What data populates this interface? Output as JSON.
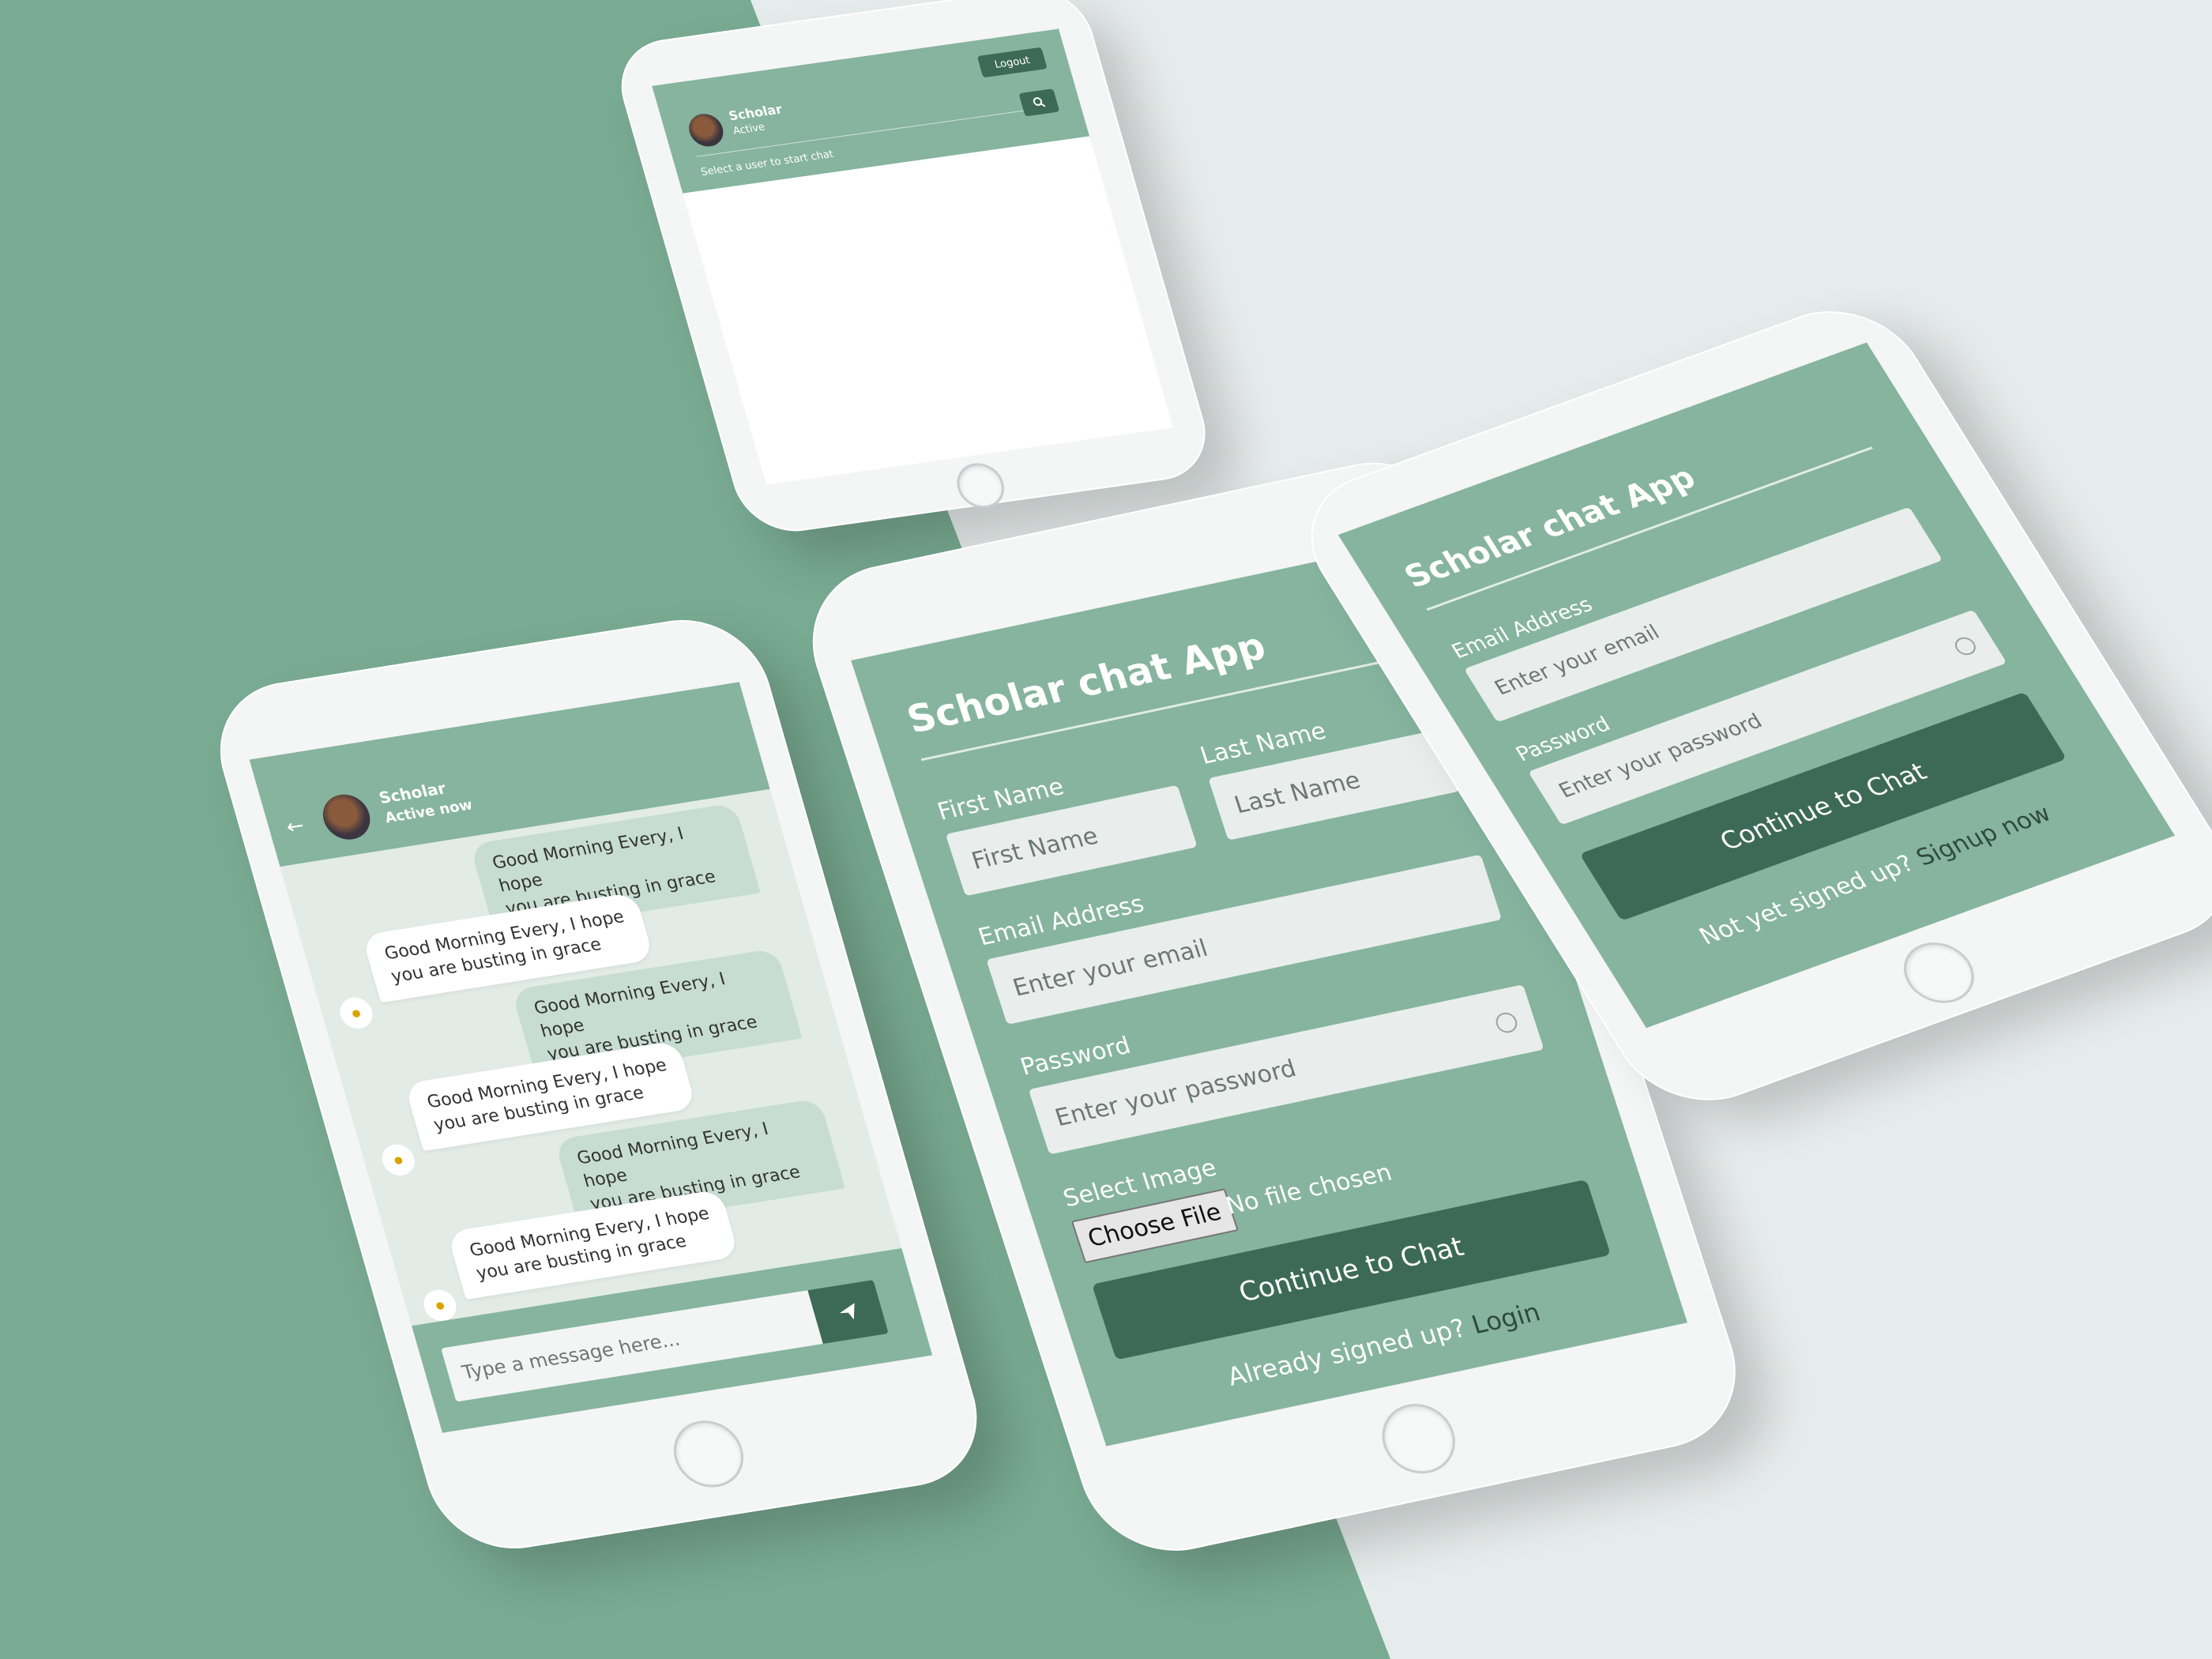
{
  "colors": {
    "brand_green": "#86b49f",
    "dark_green": "#3d6a57",
    "background_green": "#79aa92",
    "background_light": "#e6eceb",
    "field_bg": "#e9eeec"
  },
  "users_phone": {
    "user_name": "Scholar",
    "user_status": "Active",
    "logout_label": "Logout",
    "search_icon": "search-icon",
    "prompt": "Select a user to start chat"
  },
  "chat_phone": {
    "back_icon": "arrow-left-icon",
    "contact_name": "Scholar",
    "contact_status": "Active now",
    "messages": [
      {
        "dir": "out",
        "line1": "Good Morning Every, I hope",
        "line2": "you are busting in grace"
      },
      {
        "dir": "in",
        "line1": "Good Morning Every, I hope",
        "line2": "you are busting in grace"
      },
      {
        "dir": "out",
        "line1": "Good Morning Every, I hope",
        "line2": "you are busting in grace"
      },
      {
        "dir": "in",
        "line1": "Good Morning Every, I hope",
        "line2": "you are busting in grace"
      },
      {
        "dir": "out",
        "line1": "Good Morning Every, I hope",
        "line2": "you are busting in grace"
      },
      {
        "dir": "in",
        "line1": "Good Morning Every, I hope",
        "line2": "you are busting in grace"
      }
    ],
    "input_placeholder": "Type a message here...",
    "send_icon": "send-icon"
  },
  "signup_phone": {
    "title": "Scholar chat App",
    "first_name_label": "First Name",
    "first_name_placeholder": "First Name",
    "last_name_label": "Last Name",
    "last_name_placeholder": "Last Name",
    "email_label": "Email Address",
    "email_placeholder": "Enter your email",
    "password_label": "Password",
    "password_placeholder": "Enter your password",
    "eye_icon": "eye-icon",
    "image_label": "Select Image",
    "choose_file_label": "Choose File",
    "no_file_text": "No file chosen",
    "submit_label": "Continue to Chat",
    "footer_text": "Already signed up?",
    "footer_link": "Login"
  },
  "login_phone": {
    "title": "Scholar chat App",
    "email_label": "Email Address",
    "email_placeholder": "Enter your email",
    "password_label": "Password",
    "password_placeholder": "Enter your password",
    "eye_icon": "eye-icon",
    "submit_label": "Continue to Chat",
    "footer_text": "Not yet signed up?",
    "footer_link": "Signup now"
  }
}
